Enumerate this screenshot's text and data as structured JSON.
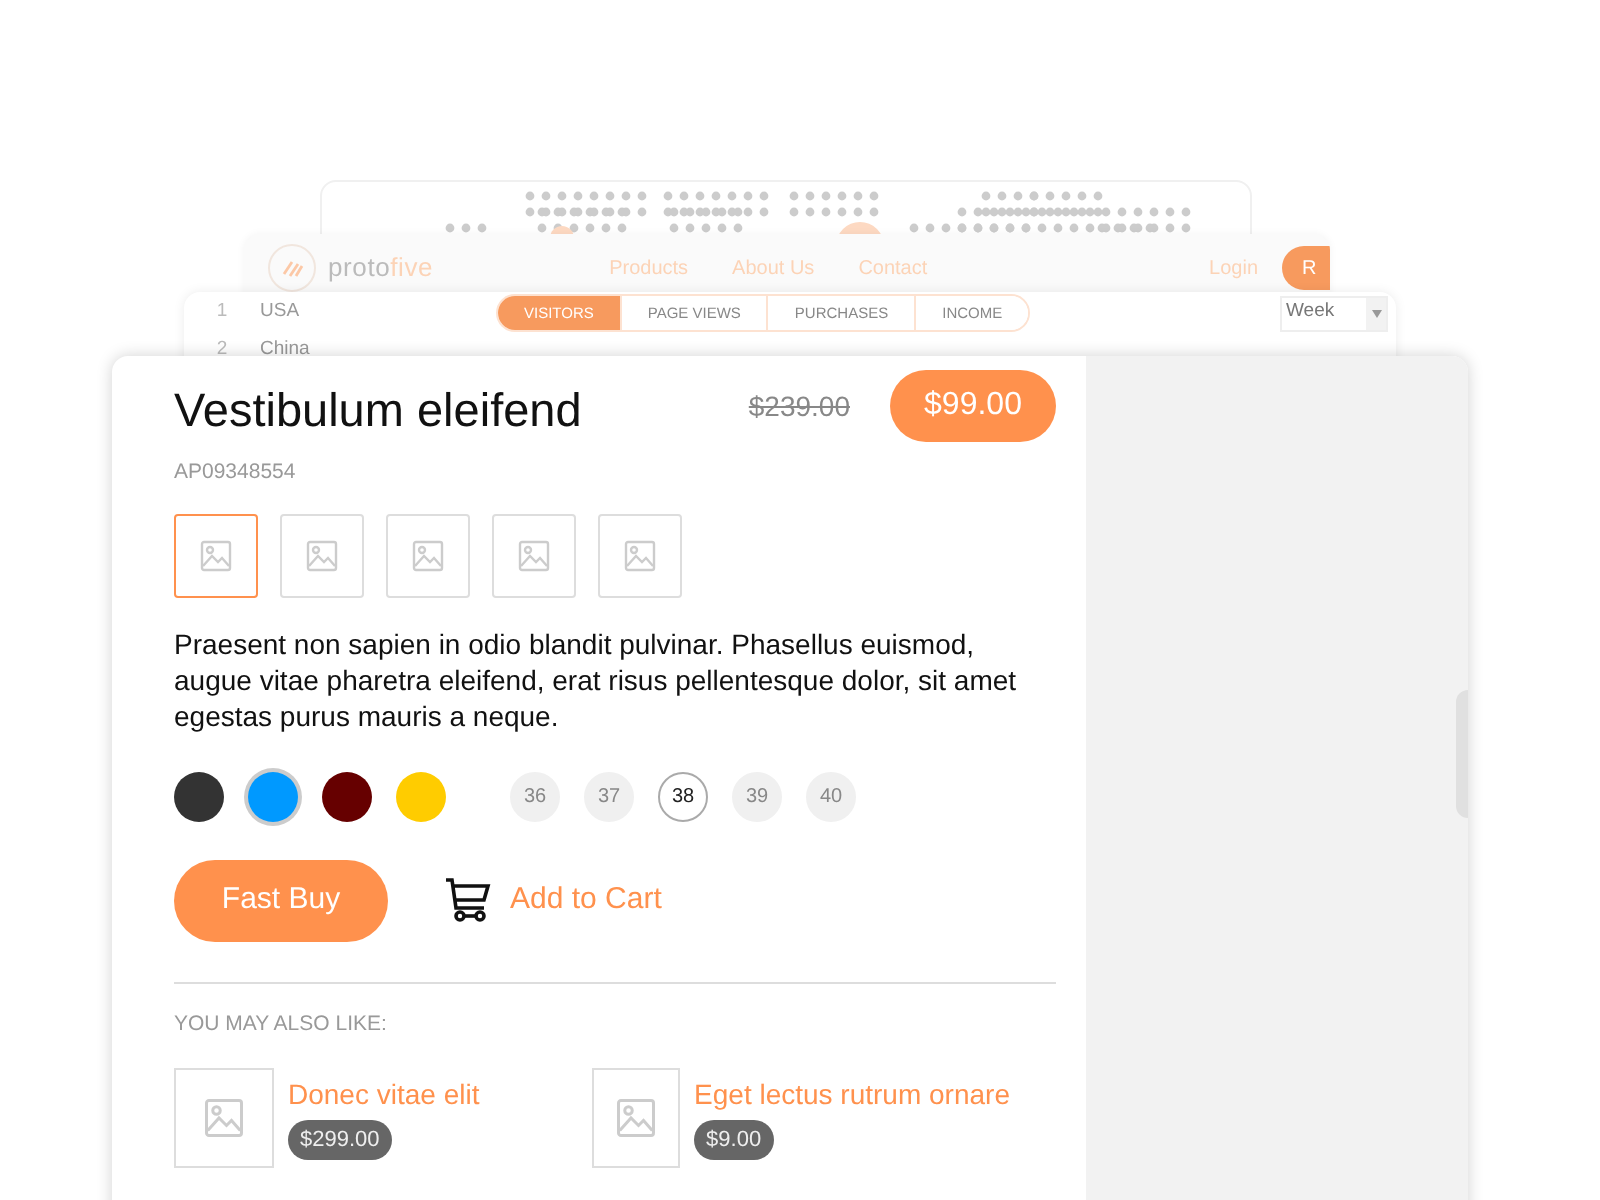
{
  "nav_window": {
    "brand": {
      "text": "proto",
      "accent": "five"
    },
    "links": [
      "Products",
      "About Us",
      "Contact"
    ],
    "login": "Login",
    "button": "R"
  },
  "stats_window": {
    "rows": [
      {
        "rank": "1",
        "country": "USA"
      },
      {
        "rank": "2",
        "country": "China"
      }
    ],
    "tabs": [
      {
        "label": "VISITORS",
        "selected": true
      },
      {
        "label": "PAGE VIEWS",
        "selected": false
      },
      {
        "label": "PURCHASES",
        "selected": false
      },
      {
        "label": "INCOME",
        "selected": false
      }
    ],
    "period": "Week"
  },
  "product": {
    "title": "Vestibulum eleifend",
    "old_price": "$239.00",
    "price": "$99.00",
    "sku": "AP09348554",
    "thumbnails": [
      {
        "selected": true
      },
      {
        "selected": false
      },
      {
        "selected": false
      },
      {
        "selected": false
      },
      {
        "selected": false
      }
    ],
    "description": "Praesent non sapien in odio blandit pulvinar. Phasellus euismod, augue vitae pharetra eleifend, erat risus pellentesque dolor, sit amet egestas purus mauris a neque.",
    "colors": [
      {
        "color": "#333333",
        "selected": false
      },
      {
        "color": "#0099ff",
        "selected": true
      },
      {
        "color": "#660000",
        "selected": false
      },
      {
        "color": "#ffcc00",
        "selected": false
      }
    ],
    "sizes": [
      {
        "label": "36",
        "selected": false
      },
      {
        "label": "37",
        "selected": false
      },
      {
        "label": "38",
        "selected": true
      },
      {
        "label": "39",
        "selected": false
      },
      {
        "label": "40",
        "selected": false
      }
    ],
    "fast_buy": "Fast Buy",
    "add_to_cart": "Add to Cart"
  },
  "related": {
    "heading": "YOU MAY ALSO LIKE:",
    "items": [
      {
        "title": "Donec vitae elit",
        "price": "$299.00"
      },
      {
        "title": "Eget lectus rutrum ornare",
        "price": "$9.00"
      }
    ]
  }
}
